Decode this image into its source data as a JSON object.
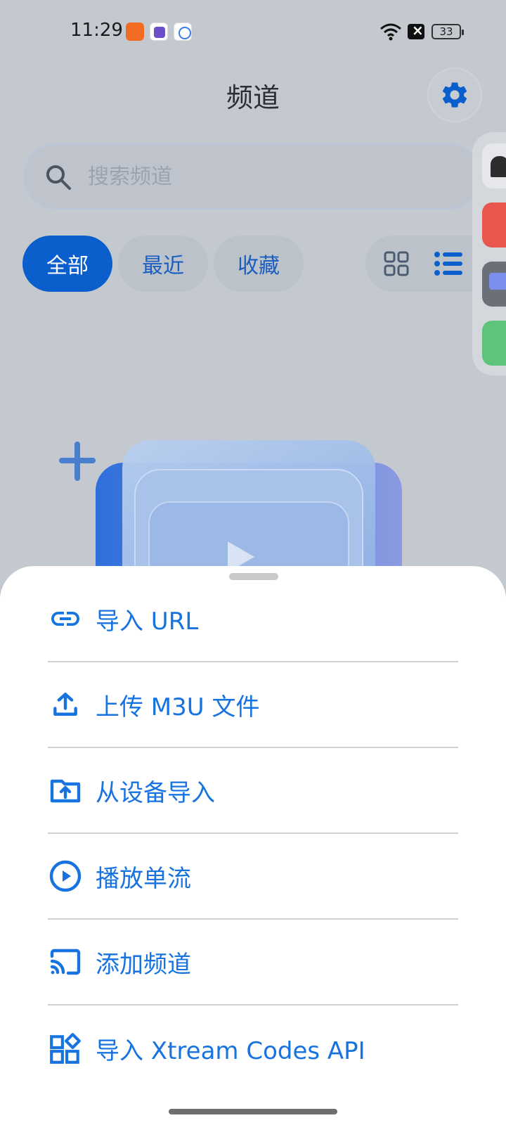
{
  "status_bar": {
    "time": "11:29",
    "battery": "33",
    "notification_icons": [
      "grid-app-icon",
      "tie-app-icon",
      "cloud-app-icon"
    ]
  },
  "header": {
    "title": "频道",
    "settings_icon": "gear-icon"
  },
  "search": {
    "placeholder": "搜索频道"
  },
  "filters": {
    "items": [
      {
        "label": "全部",
        "selected": true
      },
      {
        "label": "最近",
        "selected": false
      },
      {
        "label": "收藏",
        "selected": false
      }
    ],
    "view_modes": [
      "grid-view-icon",
      "list-view-icon"
    ],
    "active_view": "list"
  },
  "colors": {
    "accent": "#0b5fcc",
    "menu_text": "#1673e0",
    "background_dim": "#c4c9d0",
    "sheet_bg": "#ffffff"
  },
  "sheet": {
    "items": [
      {
        "label": "导入 URL",
        "icon": "link-icon"
      },
      {
        "label": "上传 M3U 文件",
        "icon": "upload-icon"
      },
      {
        "label": "从设备导入",
        "icon": "folder-upload-icon"
      },
      {
        "label": "播放单流",
        "icon": "play-circle-icon"
      },
      {
        "label": "添加频道",
        "icon": "cast-icon"
      },
      {
        "label": "导入 Xtream Codes API",
        "icon": "widgets-icon"
      }
    ]
  }
}
